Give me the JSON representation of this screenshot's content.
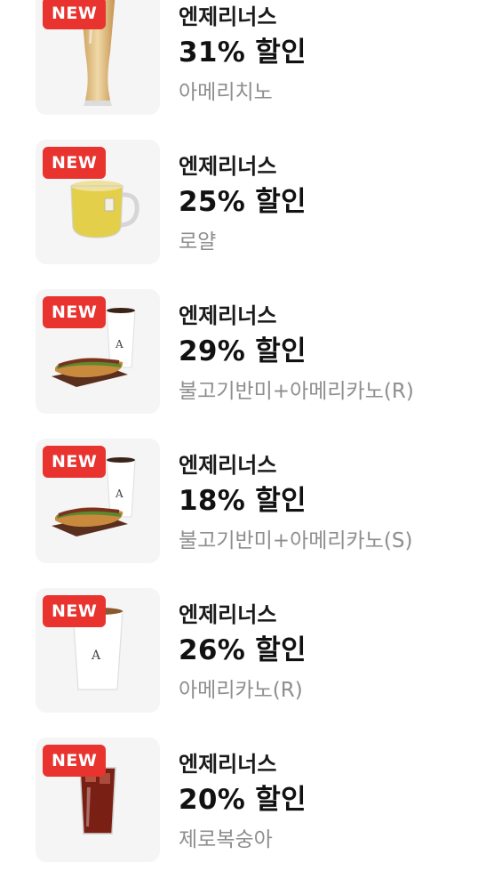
{
  "items": [
    {
      "badge": "NEW",
      "brand": "엔제리너스",
      "discount": "31% 할인",
      "product": "아메리치노",
      "image": "tall-pilsner-glass-latte"
    },
    {
      "badge": "NEW",
      "brand": "엔제리너스",
      "discount": "25% 할인",
      "product": "로얄",
      "image": "tea-mug-yellow"
    },
    {
      "badge": "NEW",
      "brand": "엔제리너스",
      "discount": "29% 할인",
      "product": "불고기반미+아메리카노(R)",
      "image": "banh-mi-and-coffee-cup"
    },
    {
      "badge": "NEW",
      "brand": "엔제리너스",
      "discount": "18% 할인",
      "product": "불고기반미+아메리카노(S)",
      "image": "banh-mi-and-coffee-cup"
    },
    {
      "badge": "NEW",
      "brand": "엔제리너스",
      "discount": "26% 할인",
      "product": "아메리카노(R)",
      "image": "paper-coffee-cup"
    },
    {
      "badge": "NEW",
      "brand": "엔제리너스",
      "discount": "20% 할인",
      "product": "제로복숭아",
      "image": "iced-red-drink-glass"
    }
  ],
  "colors": {
    "badge": "#e8332f",
    "thumb_bg": "#f5f5f5",
    "brand_text": "#1a1a1a",
    "discount_text": "#111111",
    "product_text": "#8e8e8e"
  }
}
